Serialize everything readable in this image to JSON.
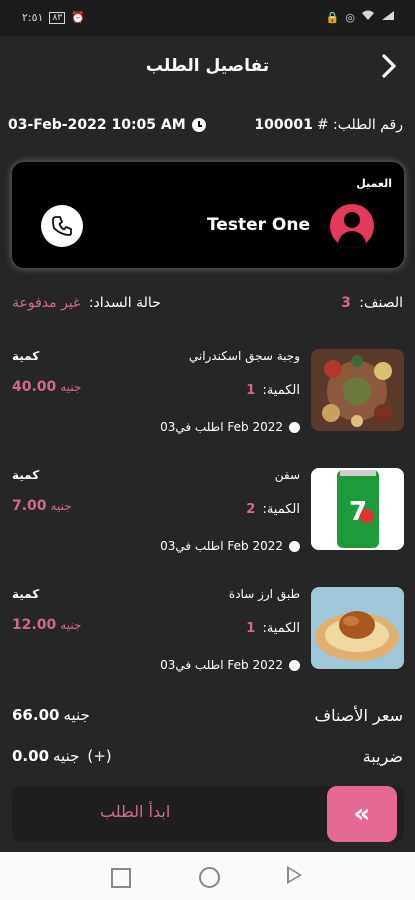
{
  "status_bar": {
    "time": "٢:٥١",
    "battery": "٨٣"
  },
  "header": {
    "title": "تفاصيل الطلب"
  },
  "order": {
    "number_label": "رقم الطلب: #",
    "number": "100001",
    "datetime": "03-Feb-2022 10:05 AM"
  },
  "customer": {
    "label": "العميل",
    "name": "Tester One"
  },
  "summary": {
    "items_label": "الصنف:",
    "items_count": "3",
    "payment_label": "حالة السداد:",
    "payment_status": "غير مدفوعة"
  },
  "items": [
    {
      "name": "وجبة سجق اسكندراني",
      "qty_label": "الكمية:",
      "qty": "1",
      "ordered_on": "اطلب في03 Feb 2022",
      "unit_label": "كمية",
      "price": "40.00",
      "currency": "جنيه"
    },
    {
      "name": "سفن",
      "qty_label": "الكمية:",
      "qty": "2",
      "ordered_on": "اطلب في03 Feb 2022",
      "unit_label": "كمية",
      "price": "7.00",
      "currency": "جنيه"
    },
    {
      "name": "طبق ارز سادة",
      "qty_label": "الكمية:",
      "qty": "1",
      "ordered_on": "اطلب في03 Feb 2022",
      "unit_label": "كمية",
      "price": "12.00",
      "currency": "جنيه"
    }
  ],
  "totals": {
    "items_price_label": "سعر الأصناف",
    "items_price": "66.00",
    "currency": "جنيه",
    "tax_label": "ضريبة",
    "tax": "0.00",
    "tax_sign": "(+)"
  },
  "action": {
    "slide_text": "ابدأ الطلب",
    "slide_icon": "«"
  },
  "icons": {
    "back": "chevron-right-icon",
    "clock": "clock-icon",
    "phone": "phone-icon",
    "avatar": "user-icon"
  },
  "colors": {
    "accent": "#d06a8c",
    "button": "#e46a95",
    "avatar": "#e23b5c"
  }
}
